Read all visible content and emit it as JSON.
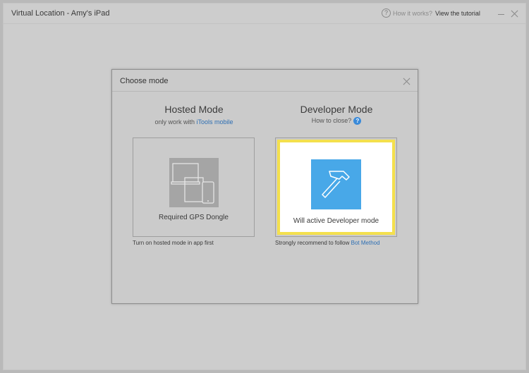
{
  "window": {
    "title": "Virtual Location - Amy's iPad",
    "help_icon": "question-circle-icon",
    "help_text": "How it works?",
    "tutorial_link": "View the tutorial",
    "minimize_icon": "minimize-icon",
    "close_icon": "close-icon"
  },
  "dialog": {
    "title": "Choose mode",
    "close_icon": "close-icon",
    "hosted": {
      "heading": "Hosted Mode",
      "sub_prefix": "only work with",
      "sub_link": "iTools mobile",
      "icon": "devices-icon",
      "card_label": "Required GPS Dongle",
      "note": "Turn on hosted mode in app first"
    },
    "developer": {
      "heading": "Developer Mode",
      "sub_text": "How to close?",
      "sub_icon": "info-question-icon",
      "icon": "hammer-icon",
      "card_label": "Will active Developer mode",
      "note_prefix": "Strongly recommend to follow",
      "note_link": "Bot Method"
    }
  },
  "colors": {
    "background": "#cdcdcd",
    "highlight_border": "#f4e04d",
    "accent_blue": "#48a8e8",
    "link_blue": "#2e6fb3"
  }
}
